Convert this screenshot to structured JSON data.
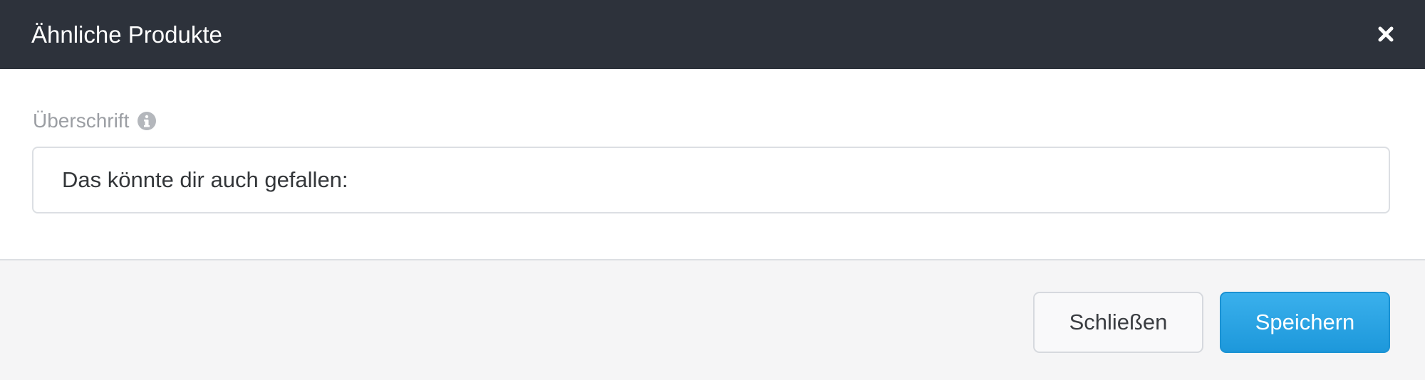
{
  "modal": {
    "title": "Ähnliche Produkte",
    "close_icon": "close-icon"
  },
  "form": {
    "label": "Überschrift",
    "info_icon": "info-icon",
    "heading_value": "Das könnte dir auch gefallen:"
  },
  "footer": {
    "close_label": "Schließen",
    "save_label": "Speichern"
  },
  "colors": {
    "header_bg": "#2d323b",
    "primary_button": "#1d98db",
    "footer_bg": "#f5f5f6"
  }
}
